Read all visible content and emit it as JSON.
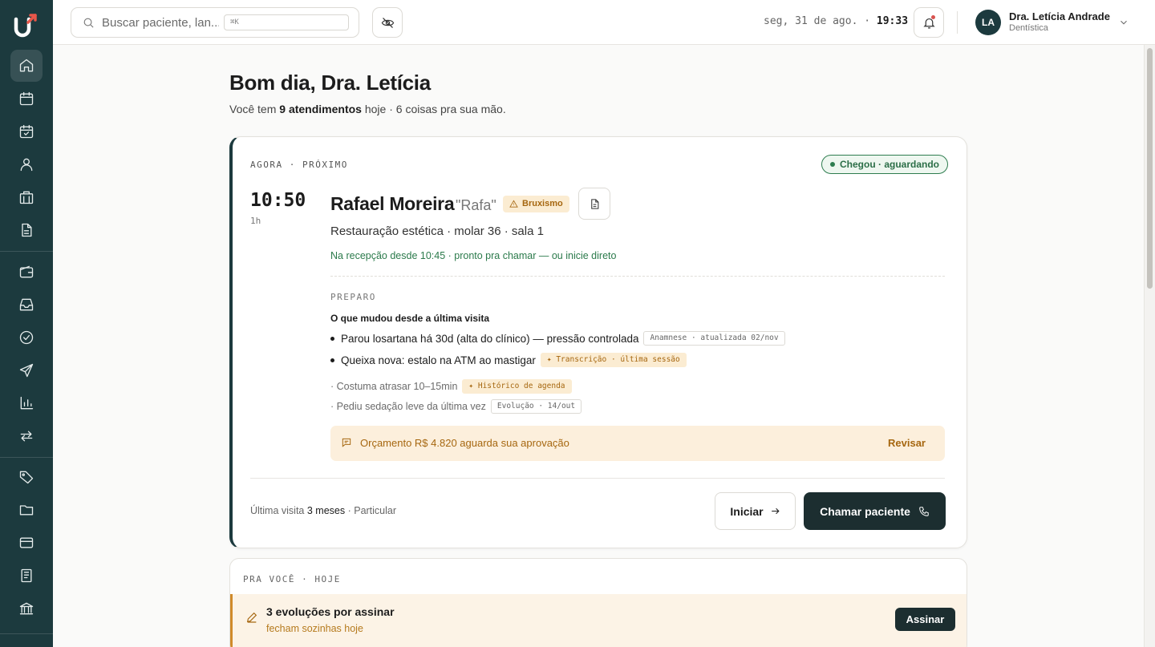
{
  "sidebar": {
    "items": [
      {
        "icon": "home-icon"
      },
      {
        "icon": "calendar-icon"
      },
      {
        "icon": "calendar-check-icon"
      },
      {
        "icon": "user-icon"
      },
      {
        "icon": "building-icon"
      },
      {
        "icon": "document-icon"
      },
      {
        "icon": "wallet-icon"
      },
      {
        "icon": "inbox-icon"
      },
      {
        "icon": "check-circle-icon"
      },
      {
        "icon": "send-icon"
      },
      {
        "icon": "bar-chart-icon"
      },
      {
        "icon": "repeat-icon"
      },
      {
        "icon": "tag-icon"
      },
      {
        "icon": "folder-icon"
      },
      {
        "icon": "credit-card-icon"
      },
      {
        "icon": "clipboard-icon"
      },
      {
        "icon": "bank-icon"
      }
    ],
    "accent": "#1c3a3e"
  },
  "header": {
    "search_placeholder": "Buscar paciente, lan...",
    "search_shortcut": "⌘K",
    "date": "seg, 31 de ago. ·",
    "time": "19:33",
    "user": {
      "initials": "LA",
      "name": "Dra. Letícia Andrade",
      "role": "Dentística"
    }
  },
  "greeting": {
    "title": "Bom dia, Dra. Letícia",
    "sub_prefix": "Você tem",
    "sub_bold": "9 atendimentos",
    "sub_suffix": "hoje · 6 coisas pra sua mão."
  },
  "next": {
    "kicker": "AGORA · PRÓXIMO",
    "status": "Chegou · aguardando",
    "time": "10:50",
    "duration": "1h",
    "patient_name": "Rafael Moreira",
    "nickname": "\"Rafa\"",
    "alert_tag": "Bruxismo",
    "procedure": "Restauração estética · molar 36 · sala 1",
    "reception": "Na recepção desde 10:45 · pronto pra chamar — ou inicie direto",
    "prep_kicker": "PREPARO",
    "prep_subtitle": "O que mudou desde a última visita",
    "changes": [
      {
        "text": "Parou losartana há 30d (alta do clínico) — pressão controlada",
        "source": "Anamnese · atualizada 02/nov",
        "ai": false
      },
      {
        "text": "Queixa nova: estalo na ATM ao mastigar",
        "source": "✦ Transcrição · última sessão",
        "ai": true
      }
    ],
    "notes": [
      {
        "text": "· Costuma atrasar 10–15min",
        "source": "✦ Histórico de agenda",
        "ai": true
      },
      {
        "text": "· Pediu sedação leve da última vez",
        "source": "Evolução · 14/out",
        "ai": false
      }
    ],
    "budget_text": "Orçamento R$ 4.820 aguarda sua aprovação",
    "budget_action": "Revisar",
    "last_visit_label": "Última visita",
    "last_visit_value": "3 meses",
    "last_visit_extra": "· Particular",
    "start_label": "Iniciar",
    "call_label": "Chamar paciente"
  },
  "for_you": {
    "kicker": "PRA VOCÊ · HOJE",
    "task_title": "3 evoluções por assinar",
    "task_sub": "fecham sozinhas hoje",
    "task_action": "Assinar"
  }
}
